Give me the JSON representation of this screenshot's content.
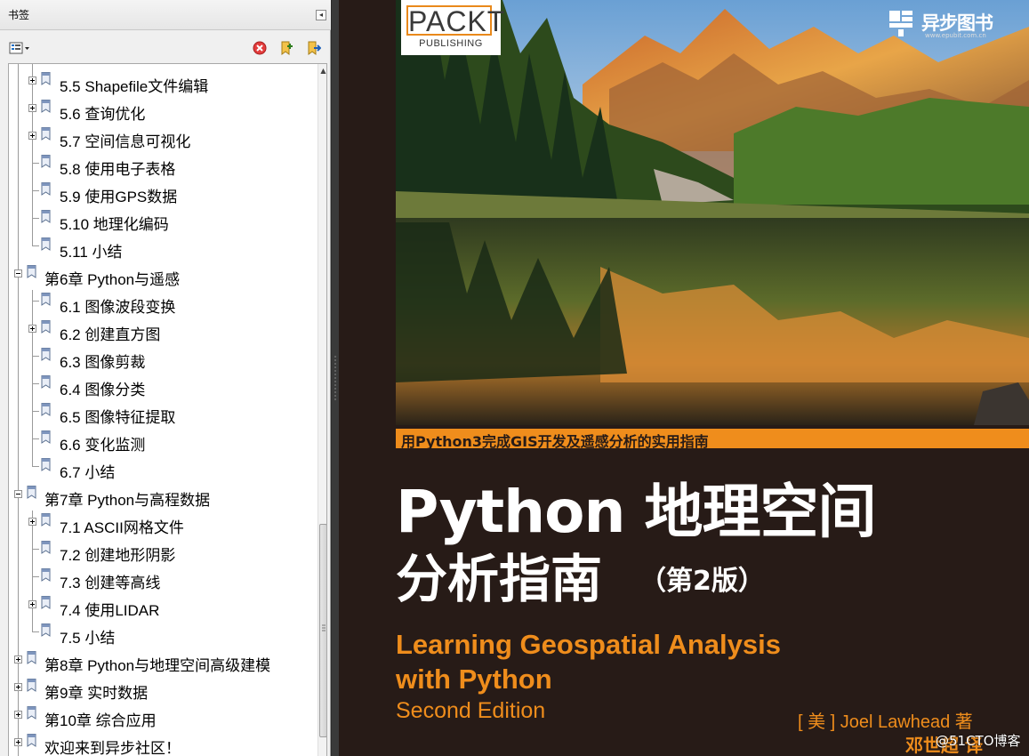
{
  "bookmarks_panel": {
    "title": "书签",
    "toolbar": {
      "options_icon": "options-menu-icon",
      "delete_icon": "delete-bookmark-icon",
      "expand_icon": "expand-bookmark-icon",
      "find_icon": "find-current-bookmark-icon"
    },
    "items": [
      {
        "label": "5.5 Shapefile文件编辑",
        "level": 2,
        "expandable": true
      },
      {
        "label": "5.6 查询优化",
        "level": 2,
        "expandable": true
      },
      {
        "label": "5.7 空间信息可视化",
        "level": 2,
        "expandable": true
      },
      {
        "label": "5.8 使用电子表格",
        "level": 2,
        "expandable": false
      },
      {
        "label": "5.9 使用GPS数据",
        "level": 2,
        "expandable": false
      },
      {
        "label": "5.10 地理化编码",
        "level": 2,
        "expandable": false
      },
      {
        "label": "5.11 小结",
        "level": 2,
        "expandable": false
      },
      {
        "label": "第6章 Python与遥感",
        "level": 1,
        "expandable": true,
        "expanded": true
      },
      {
        "label": "6.1 图像波段变换",
        "level": 2,
        "expandable": false
      },
      {
        "label": "6.2 创建直方图",
        "level": 2,
        "expandable": true
      },
      {
        "label": "6.3 图像剪裁",
        "level": 2,
        "expandable": false
      },
      {
        "label": "6.4 图像分类",
        "level": 2,
        "expandable": false
      },
      {
        "label": "6.5 图像特征提取",
        "level": 2,
        "expandable": false
      },
      {
        "label": "6.6 变化监测",
        "level": 2,
        "expandable": false
      },
      {
        "label": "6.7 小结",
        "level": 2,
        "expandable": false
      },
      {
        "label": "第7章 Python与高程数据",
        "level": 1,
        "expandable": true,
        "expanded": true
      },
      {
        "label": "7.1 ASCII网格文件",
        "level": 2,
        "expandable": true
      },
      {
        "label": "7.2 创建地形阴影",
        "level": 2,
        "expandable": false
      },
      {
        "label": "7.3 创建等高线",
        "level": 2,
        "expandable": false
      },
      {
        "label": "7.4 使用LIDAR",
        "level": 2,
        "expandable": true
      },
      {
        "label": "7.5 小结",
        "level": 2,
        "expandable": false
      },
      {
        "label": "第8章 Python与地理空间高级建模",
        "level": 1,
        "expandable": true
      },
      {
        "label": "第9章 实时数据",
        "level": 1,
        "expandable": true
      },
      {
        "label": "第10章 综合应用",
        "level": 1,
        "expandable": true
      },
      {
        "label": "欢迎来到异步社区！",
        "level": 1,
        "expandable": true
      }
    ]
  },
  "cover": {
    "publisher_logo_top": "PACKT",
    "publisher_logo_bottom": "PUBLISHING",
    "imprint_name": "异步图书",
    "imprint_url": "www.epubit.com.cn",
    "tagline": "用Python3完成GIS开发及遥感分析的实用指南",
    "title_cn_line1": "Python 地理空间",
    "title_cn_line2": "分析指南",
    "edition_cn": "（第2版）",
    "title_en_line1": "Learning Geospatial Analysis",
    "title_en_line2": "with Python",
    "title_en_line3": "Second Edition",
    "author": "[ 美 ] Joel Lawhead  著",
    "translator": "邓世超  译",
    "watermark": "@51CTO博客",
    "colors": {
      "accent": "#ef8d1c",
      "background": "#271b17"
    }
  }
}
